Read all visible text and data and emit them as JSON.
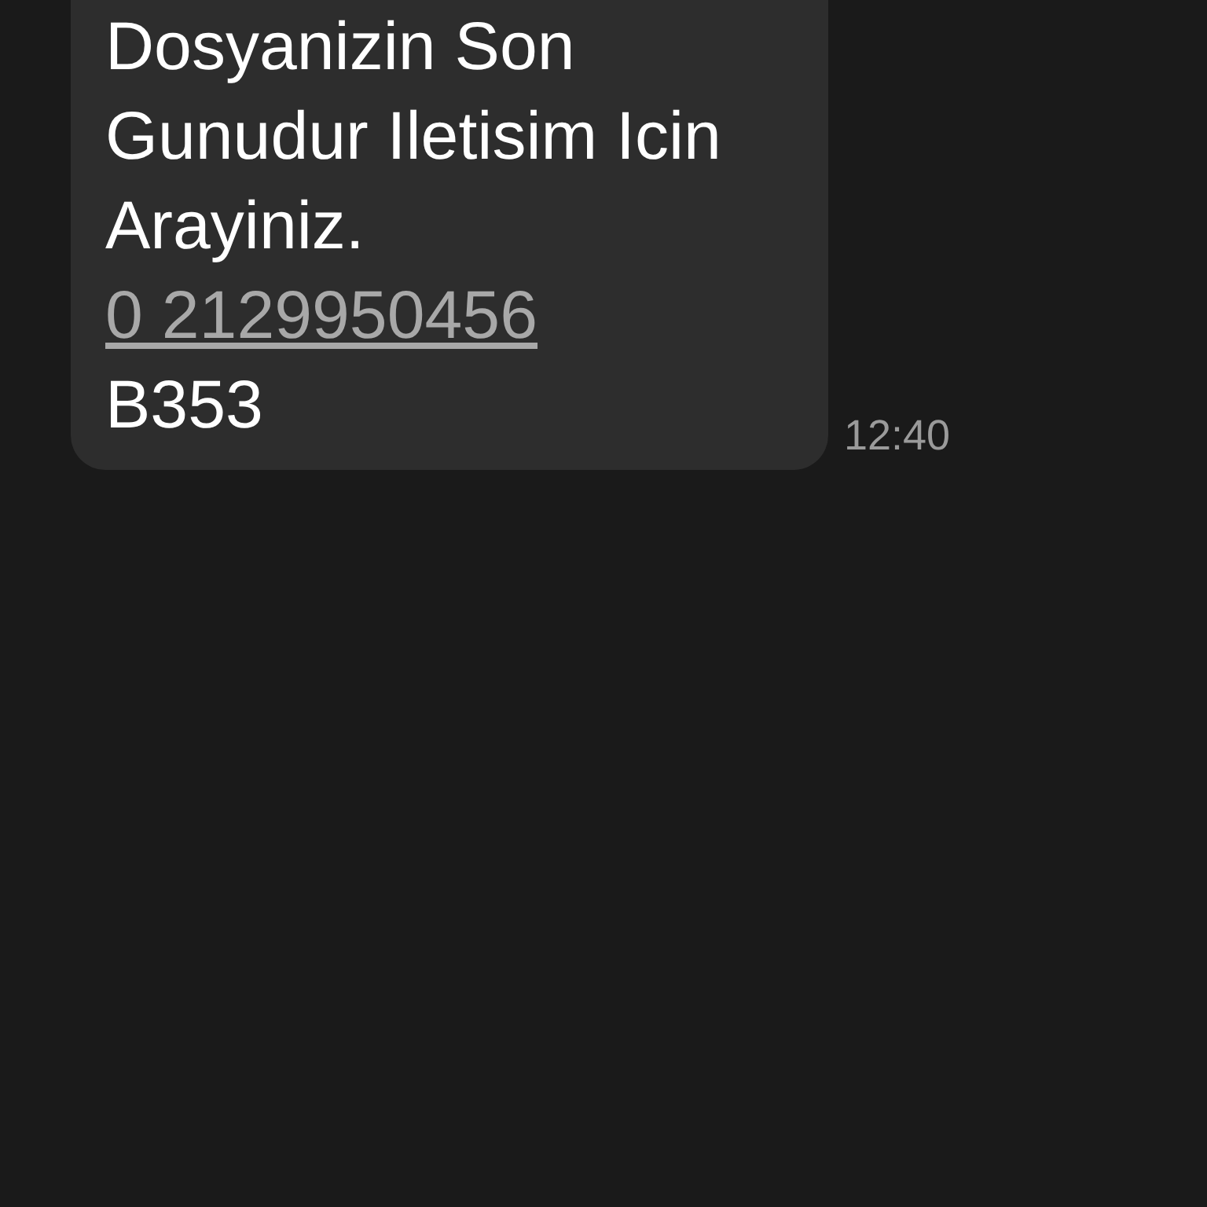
{
  "message": {
    "text": "Dosyanizin Son Gunudur Iletisim Icin Arayiniz.",
    "link": "0 2129950456",
    "code": "B353",
    "time": "12:40"
  }
}
